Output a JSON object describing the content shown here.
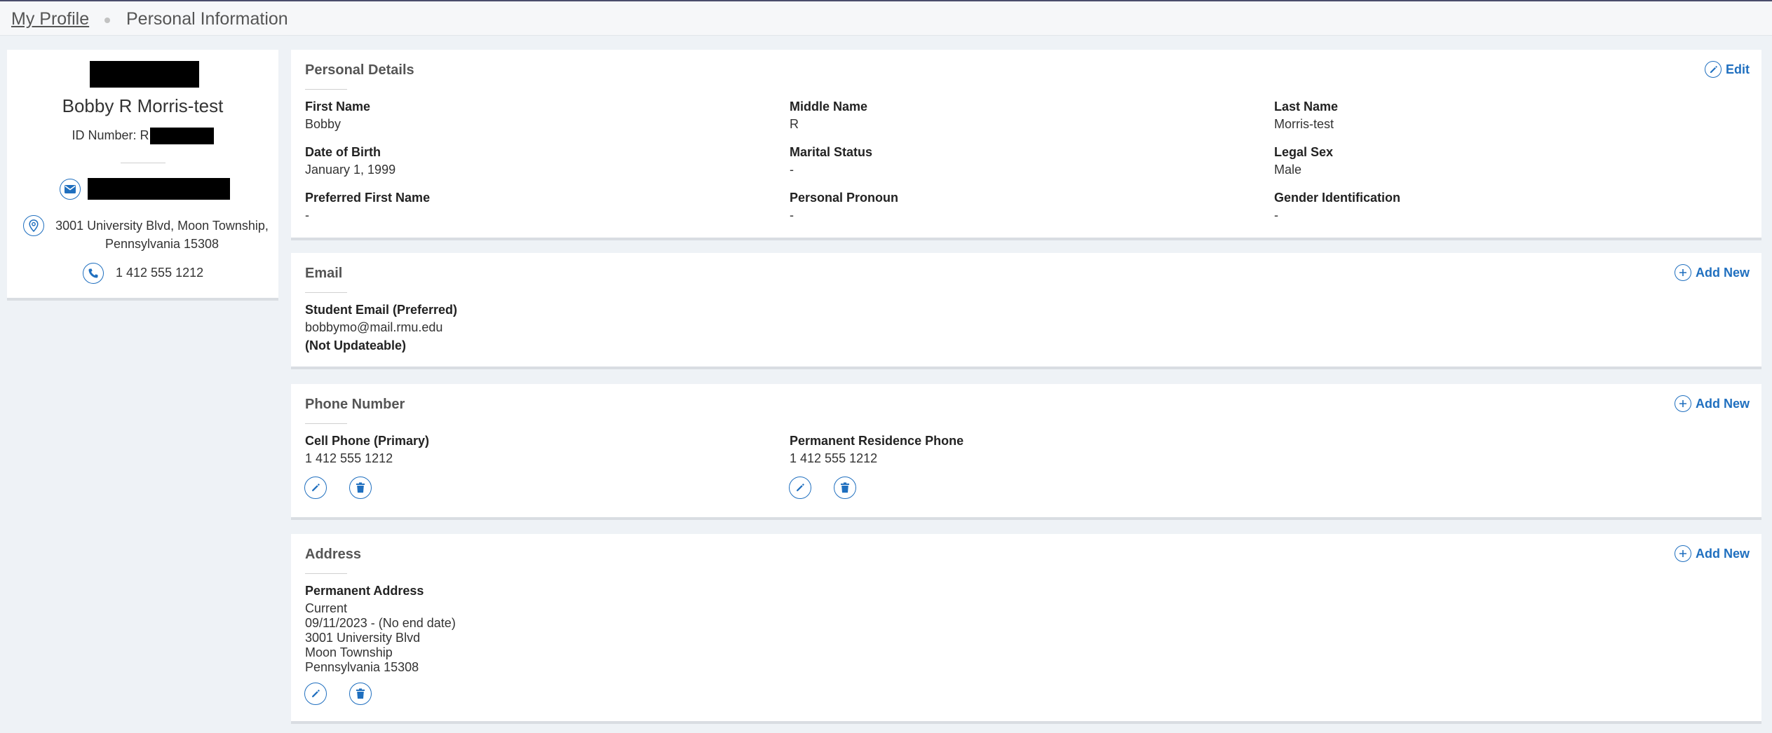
{
  "breadcrumb": {
    "parent": "My Profile",
    "current": "Personal Information"
  },
  "profile": {
    "name": "Bobby R Morris-test",
    "id_label": "ID Number: R",
    "address_line1": "3001 University Blvd, Moon Township,",
    "address_line2": "Pennsylvania 15308",
    "phone": "1 412 555 1212"
  },
  "personal_details": {
    "title": "Personal Details",
    "edit_label": "Edit",
    "fields": [
      {
        "label": "First Name",
        "value": "Bobby"
      },
      {
        "label": "Middle Name",
        "value": "R"
      },
      {
        "label": "Last Name",
        "value": "Morris-test"
      },
      {
        "label": "Date of Birth",
        "value": "January 1, 1999"
      },
      {
        "label": "Marital Status",
        "value": "-"
      },
      {
        "label": "Legal Sex",
        "value": "Male"
      },
      {
        "label": "Preferred First Name",
        "value": "-"
      },
      {
        "label": "Personal Pronoun",
        "value": "-"
      },
      {
        "label": "Gender Identification",
        "value": "-"
      }
    ]
  },
  "email": {
    "title": "Email",
    "add_label": "Add New",
    "type": "Student Email (Preferred)",
    "address": "bobbymo@mail.rmu.edu",
    "note": "(Not Updateable)"
  },
  "phone_section": {
    "title": "Phone Number",
    "add_label": "Add New",
    "items": [
      {
        "type": "Cell Phone (Primary)",
        "number": "1 412 555 1212"
      },
      {
        "type": "Permanent Residence Phone",
        "number": "1 412 555 1212"
      }
    ]
  },
  "address_section": {
    "title": "Address",
    "add_label": "Add New",
    "type": "Permanent Address",
    "status": "Current",
    "dates": "09/11/2023 - (No end date)",
    "line1": "3001 University Blvd",
    "line2": "Moon Township",
    "line3": "Pennsylvania 15308"
  },
  "colors": {
    "accent": "#1f6fbf",
    "page_bg": "#eef2f6",
    "redaction": "#000000"
  },
  "icons": [
    "mail-icon",
    "location-pin-icon",
    "phone-icon",
    "pencil-icon",
    "plus-icon",
    "trash-icon"
  ]
}
